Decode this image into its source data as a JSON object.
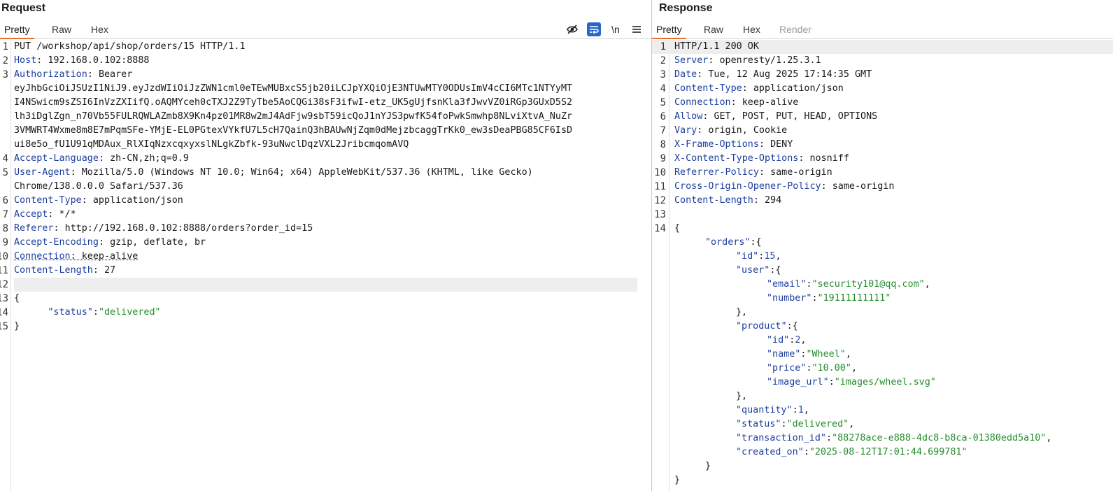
{
  "request": {
    "title": "Request",
    "tabs": [
      "Pretty",
      "Raw",
      "Hex"
    ],
    "active_tab": "Pretty",
    "toolbar_icons": [
      "hide-icon",
      "wrap-lines-icon",
      "newline-icon",
      "menu-icon"
    ],
    "newline_label": "\\n",
    "line_numbers": [
      "1",
      "2",
      "3",
      "4",
      "5",
      "6",
      "7",
      "8",
      "9",
      "10",
      "11",
      "12",
      "13",
      "14",
      "15"
    ],
    "request_line": "PUT /workshop/api/shop/orders/15 HTTP/1.1",
    "headers": [
      {
        "name": "Host",
        "value": "192.168.0.102:8888"
      },
      {
        "name": "Authorization",
        "value": "Bearer"
      },
      {
        "name": "Accept-Language",
        "value": "zh-CN,zh;q=0.9"
      },
      {
        "name": "User-Agent",
        "value": "Mozilla/5.0 (Windows NT 10.0; Win64; x64) AppleWebKit/537.36 (KHTML, like Gecko)"
      },
      {
        "name": "Content-Type",
        "value": "application/json"
      },
      {
        "name": "Accept",
        "value": "*/*"
      },
      {
        "name": "Referer",
        "value": "http://192.168.0.102:8888/orders?order_id=15"
      },
      {
        "name": "Accept-Encoding",
        "value": "gzip, deflate, br"
      },
      {
        "name": "Connection",
        "value": "keep-alive"
      },
      {
        "name": "Content-Length",
        "value": "27"
      }
    ],
    "token_lines": [
      "eyJhbGciOiJSUzI1NiJ9.eyJzdWIiOiJzZWN1cml0eTEwMUBxcS5jb20iLCJpYXQiOjE3NTUwMTY0ODUsImV4cCI6MTc1NTYyMT",
      "I4NSwicm9sZSI6InVzZXIifQ.oAQMYceh0cTXJ2Z9TyTbe5AoCQGi38sF3ifwI-etz_UK5gUjfsnKla3fJwvVZ0iRGp3GUxD5S2",
      "lh3iDglZgn_n70Vb55FULRQWLAZmb8X9Kn4pz01MR8w2mJ4AdFjw9sbT59icQoJ1nYJS3pwfK54foPwkSmwhp8NLviXtvA_NuZr",
      "3VMWRT4Wxme8m8E7mPqmSFe-YMjE-EL0PGtexVYkfU7L5cH7QainQ3hBAUwNjZqm0dMejzbcaggTrKk0_ew3sDeaPBG85CF6IsD",
      "ui8e5o_fU1U91qMDAux_RlXIqNzxcqxyxslNLgkZbfk-93uNwclDqzVXL2JribcmqomAVQ"
    ],
    "ua_continuation": "Chrome/138.0.0.0 Safari/537.36",
    "body_open": "{",
    "body_key": "\"status\"",
    "body_value": "\"delivered\"",
    "body_close": "}"
  },
  "response": {
    "title": "Response",
    "tabs": [
      "Pretty",
      "Raw",
      "Hex",
      "Render"
    ],
    "active_tab": "Pretty",
    "line_numbers": [
      "1",
      "2",
      "3",
      "4",
      "5",
      "6",
      "7",
      "8",
      "9",
      "10",
      "11",
      "12",
      "13",
      "14"
    ],
    "status_line": "HTTP/1.1 200 OK",
    "headers": [
      {
        "name": "Server",
        "value": "openresty/1.25.3.1"
      },
      {
        "name": "Date",
        "value": "Tue, 12 Aug 2025 17:14:35 GMT"
      },
      {
        "name": "Content-Type",
        "value": "application/json"
      },
      {
        "name": "Connection",
        "value": "keep-alive"
      },
      {
        "name": "Allow",
        "value": "GET, POST, PUT, HEAD, OPTIONS"
      },
      {
        "name": "Vary",
        "value": "origin, Cookie"
      },
      {
        "name": "X-Frame-Options",
        "value": "DENY"
      },
      {
        "name": "X-Content-Type-Options",
        "value": "nosniff"
      },
      {
        "name": "Referrer-Policy",
        "value": "same-origin"
      },
      {
        "name": "Cross-Origin-Opener-Policy",
        "value": "same-origin"
      },
      {
        "name": "Content-Length",
        "value": "294"
      }
    ],
    "json_lines": [
      {
        "indent": 0,
        "key": null,
        "value": null,
        "punct": "{"
      },
      {
        "indent": 1,
        "key": "\"orders\"",
        "value": null,
        "punct": ":{"
      },
      {
        "indent": 2,
        "key": "\"id\"",
        "value": "15",
        "vtype": "num",
        "punct": ","
      },
      {
        "indent": 2,
        "key": "\"user\"",
        "value": null,
        "punct": ":{"
      },
      {
        "indent": 3,
        "key": "\"email\"",
        "value": "\"security101@qq.com\"",
        "vtype": "str",
        "punct": ","
      },
      {
        "indent": 3,
        "key": "\"number\"",
        "value": "\"19111111111\"",
        "vtype": "str",
        "punct": ""
      },
      {
        "indent": 2,
        "key": null,
        "value": null,
        "punct": "},"
      },
      {
        "indent": 2,
        "key": "\"product\"",
        "value": null,
        "punct": ":{"
      },
      {
        "indent": 3,
        "key": "\"id\"",
        "value": "2",
        "vtype": "num",
        "punct": ","
      },
      {
        "indent": 3,
        "key": "\"name\"",
        "value": "\"Wheel\"",
        "vtype": "str",
        "punct": ","
      },
      {
        "indent": 3,
        "key": "\"price\"",
        "value": "\"10.00\"",
        "vtype": "str",
        "punct": ","
      },
      {
        "indent": 3,
        "key": "\"image_url\"",
        "value": "\"images/wheel.svg\"",
        "vtype": "str",
        "punct": ""
      },
      {
        "indent": 2,
        "key": null,
        "value": null,
        "punct": "},"
      },
      {
        "indent": 2,
        "key": "\"quantity\"",
        "value": "1",
        "vtype": "num",
        "punct": ","
      },
      {
        "indent": 2,
        "key": "\"status\"",
        "value": "\"delivered\"",
        "vtype": "str",
        "punct": ","
      },
      {
        "indent": 2,
        "key": "\"transaction_id\"",
        "value": "\"88278ace-e888-4dc8-b8ca-01380edd5a10\"",
        "vtype": "str",
        "punct": ","
      },
      {
        "indent": 2,
        "key": "\"created_on\"",
        "value": "\"2025-08-12T17:01:44.699781\"",
        "vtype": "str",
        "punct": ""
      },
      {
        "indent": 1,
        "key": null,
        "value": null,
        "punct": "}"
      },
      {
        "indent": 0,
        "key": null,
        "value": null,
        "punct": "}"
      }
    ]
  }
}
